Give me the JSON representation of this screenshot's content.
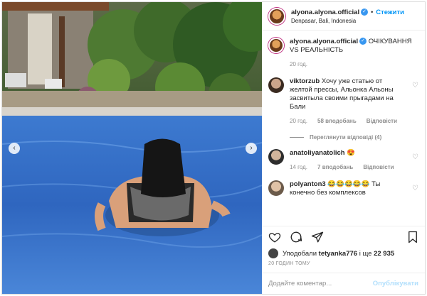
{
  "header": {
    "username": "alyona.alyona.official",
    "follow_label": "Стежити",
    "location": "Denpasar, Bali, Indonesia",
    "more_icon": "•••"
  },
  "caption": {
    "username": "alyona.alyona.official",
    "text": "ОЧІКУВАННЯ VS РЕАЛЬНІСТЬ",
    "time": "20 год."
  },
  "comments": [
    {
      "username": "viktorzub",
      "text": "Хочу уже статью от желтой прессы, Альонка Альоны засвитыла своими прыгадами на Бали",
      "time": "20 год.",
      "likes": "58 вподобань",
      "reply": "Відповісти",
      "view_replies": "Переглянути відповіді (4)"
    },
    {
      "username": "anatoliyanatolich",
      "text": "😍",
      "time": "14 год.",
      "likes": "7 вподобань",
      "reply": "Відповісти"
    },
    {
      "username": "polyanton3",
      "text": "😂😂😂😂😂 Ты конечно без комплексов"
    }
  ],
  "likes_line": {
    "prefix": "Уподобали",
    "user": "tetyanka776",
    "middle": "і ще",
    "count": "22 935"
  },
  "timestamp": "20 ГОДИН ТОМУ",
  "comment_input": {
    "placeholder": "Додайте коментар...",
    "publish_label": "Опублікувати"
  },
  "colors": {
    "accent": "#0095f6",
    "verified": "#3897f0",
    "pool": "#3b6fb0"
  }
}
